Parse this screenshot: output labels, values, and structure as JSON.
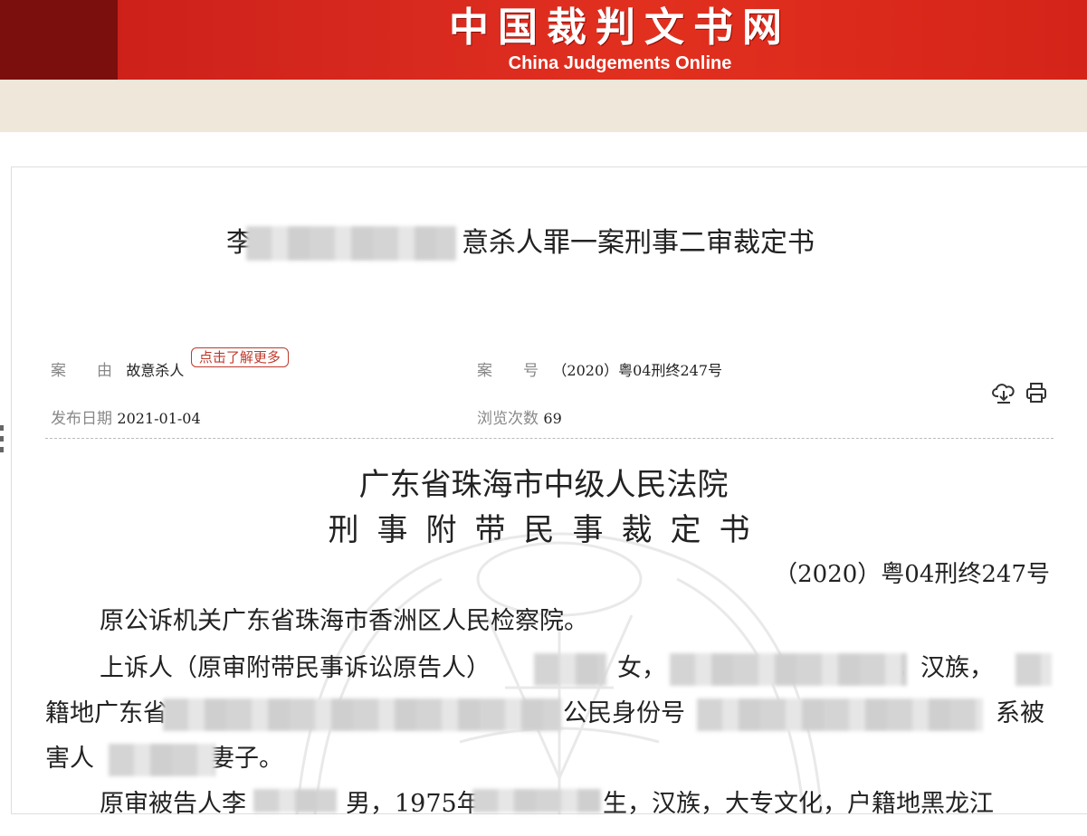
{
  "header": {
    "logo_cn": "中国裁判文书网",
    "logo_en": "China Judgements Online"
  },
  "document": {
    "title_prefix": "李",
    "title_suffix": "意杀人罪一案刑事二审裁定书",
    "meta": {
      "cause_label": "案　　由",
      "cause_value": "故意杀人",
      "learn_more": "点击了解更多",
      "case_no_label": "案　　号",
      "case_no_value": "（2020）粤04刑终247号",
      "publish_date_label": "发布日期",
      "publish_date_value": "2021-01-04",
      "views_label": "浏览次数",
      "views_value": "69"
    },
    "court_name": "广东省珠海市中级人民法院",
    "doc_type": "刑事附带民事裁定书",
    "case_number": "（2020）粤04刑终247号",
    "paragraphs": {
      "p1": "原公诉机关广东省珠海市香洲区人民检察院。",
      "p2_a": "上诉人（原审附带民事诉讼原告人）",
      "p2_b": "女，",
      "p2_c": "，汉族，",
      "p3_a": "籍地广东省",
      "p3_b": "公民身份号",
      "p3_c": "系被",
      "p4_a": "害人",
      "p4_b": "妻子。",
      "p5_a": "原审被告人李",
      "p5_b": "男，1975年",
      "p5_c": "生，汉族，大专文化，户籍地黑龙江"
    }
  },
  "colors": {
    "banner_red": "#d92a1f",
    "banner_dark": "#7b0f0d",
    "subbar": "#efe8da",
    "accent_red": "#c0392b"
  },
  "icons": [
    "download-icon",
    "print-icon"
  ]
}
